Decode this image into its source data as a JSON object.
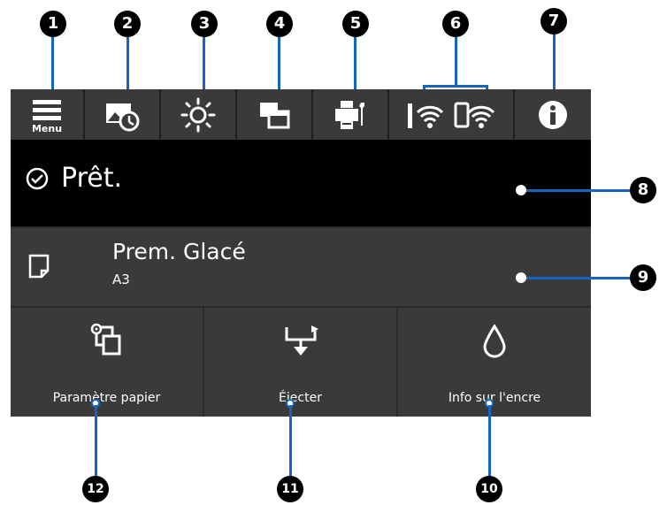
{
  "top_icons": [
    {
      "name": "menu",
      "label": "Menu"
    },
    {
      "name": "image-clock"
    },
    {
      "name": "brightness"
    },
    {
      "name": "windows"
    },
    {
      "name": "printer-maintenance"
    },
    {
      "name": "wifi-direct"
    },
    {
      "name": "info"
    }
  ],
  "status": {
    "text": "Prêt."
  },
  "paper": {
    "name": "Prem. Glacé",
    "size": "A3"
  },
  "bottom_buttons": [
    {
      "label": "Paramètre papier",
      "icon": "paper-settings"
    },
    {
      "label": "Éjecter",
      "icon": "eject"
    },
    {
      "label": "Info sur l'encre",
      "icon": "ink-drop"
    }
  ],
  "callouts": [
    "1",
    "2",
    "3",
    "4",
    "5",
    "6",
    "7",
    "8",
    "9",
    "10",
    "11",
    "12"
  ],
  "colors": {
    "screen_bg": "#2b2b2b",
    "button_bg": "#3a3a3a",
    "status_bg": "#000000",
    "callout_line": "#1565c0"
  }
}
